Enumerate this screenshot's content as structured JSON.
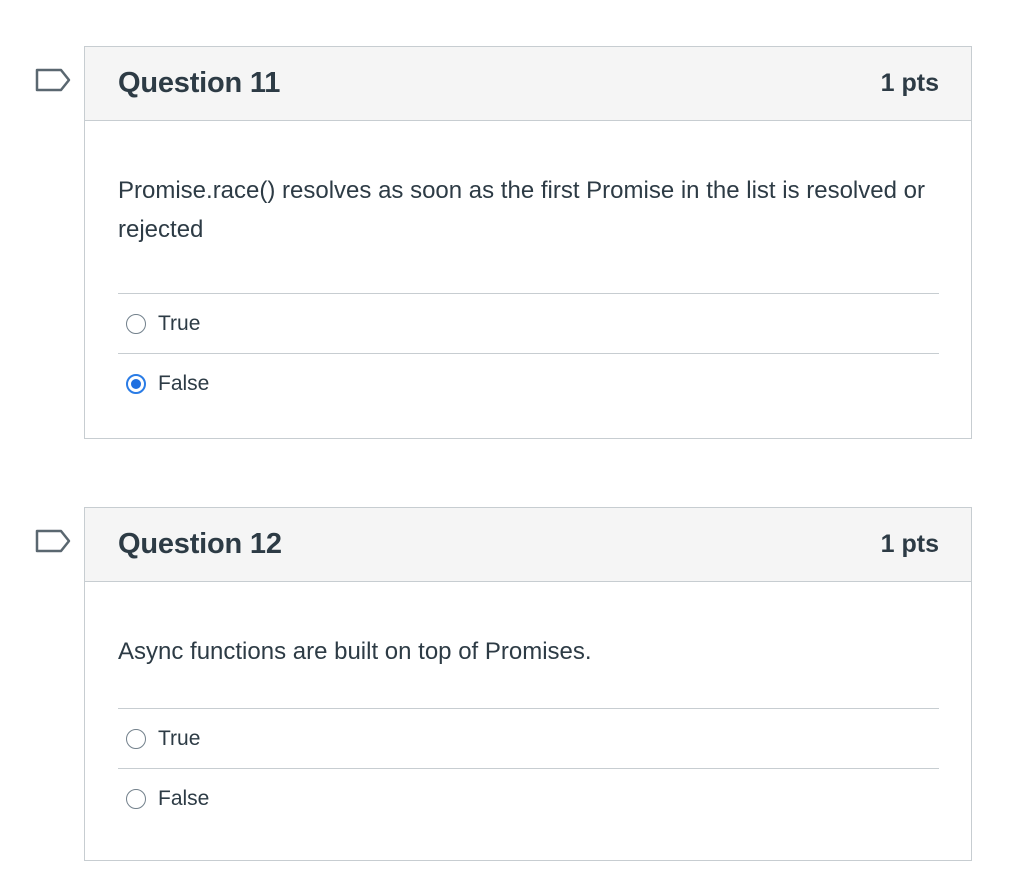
{
  "questions": [
    {
      "title": "Question 11",
      "points": "1 pts",
      "text": "Promise.race() resolves as soon as the first Promise in the list is resolved or rejected",
      "answers": [
        {
          "label": "True",
          "selected": false
        },
        {
          "label": "False",
          "selected": true
        }
      ]
    },
    {
      "title": "Question 12",
      "points": "1 pts",
      "text": "Async functions are built on top of Promises.",
      "answers": [
        {
          "label": "True",
          "selected": false
        },
        {
          "label": "False",
          "selected": false
        }
      ]
    }
  ],
  "colors": {
    "accent": "#1f6fe0",
    "border": "#c7cdd1",
    "header_bg": "#f5f5f5",
    "text": "#2d3b45"
  },
  "icons": {
    "flag": "bookmark-flag-icon"
  }
}
